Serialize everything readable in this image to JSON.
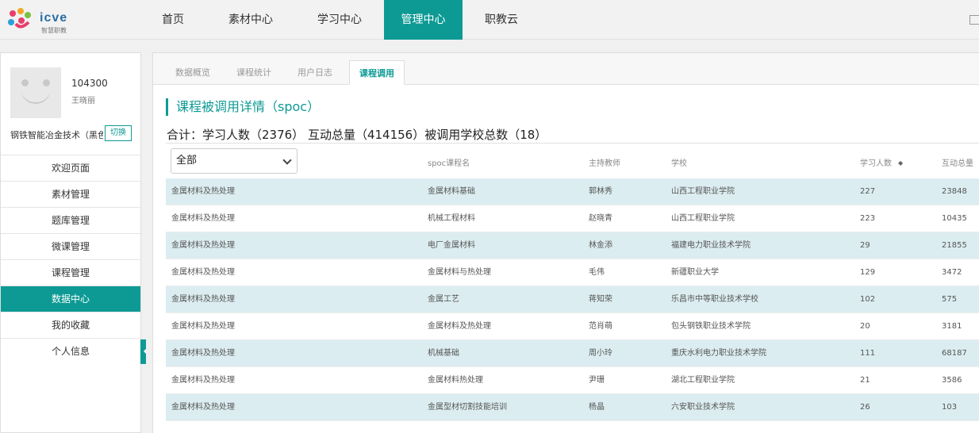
{
  "logo": {
    "text": "icve",
    "subtitle": "智慧职教"
  },
  "nav": [
    {
      "label": "首页"
    },
    {
      "label": "素材中心"
    },
    {
      "label": "学习中心"
    },
    {
      "label": "管理中心"
    },
    {
      "label": "职教云"
    }
  ],
  "user": {
    "id": "104300",
    "name": "王晓丽",
    "course": "钢铁智能冶金技术（黑色冶",
    "switch_label": "切换"
  },
  "menu": [
    {
      "label": "欢迎页面"
    },
    {
      "label": "素材管理"
    },
    {
      "label": "题库管理"
    },
    {
      "label": "微课管理"
    },
    {
      "label": "课程管理"
    },
    {
      "label": "数据中心"
    },
    {
      "label": "我的收藏"
    },
    {
      "label": "个人信息"
    }
  ],
  "tabs": [
    {
      "label": "数据概览"
    },
    {
      "label": "课程统计"
    },
    {
      "label": "用户日志"
    },
    {
      "label": "课程调用"
    }
  ],
  "section_title": "课程被调用详情（spoc）",
  "summary": "合计：学习人数（2376） 互动总量（414156）被调用学校总数（18）",
  "filter": {
    "value": "全部"
  },
  "columns": {
    "spoc": "spoc课程名",
    "teacher": "主持教师",
    "school": "学校",
    "learners": "学习人数",
    "interactions": "互动总量"
  },
  "rows": [
    {
      "course": "金属材料及热处理",
      "spoc": "金属材料基础",
      "teacher": "郭林秀",
      "school": "山西工程职业学院",
      "learners": "227",
      "interactions": "23848"
    },
    {
      "course": "金属材料及热处理",
      "spoc": "机械工程材料",
      "teacher": "赵晓青",
      "school": "山西工程职业学院",
      "learners": "223",
      "interactions": "10435"
    },
    {
      "course": "金属材料及热处理",
      "spoc": "电厂金属材料",
      "teacher": "林金添",
      "school": "福建电力职业技术学院",
      "learners": "29",
      "interactions": "21855"
    },
    {
      "course": "金属材料及热处理",
      "spoc": "金属材料与热处理",
      "teacher": "毛伟",
      "school": "新疆职业大学",
      "learners": "129",
      "interactions": "3472"
    },
    {
      "course": "金属材料及热处理",
      "spoc": "金属工艺",
      "teacher": "蒋知荣",
      "school": "乐昌市中等职业技术学校",
      "learners": "102",
      "interactions": "575"
    },
    {
      "course": "金属材料及热处理",
      "spoc": "金属材料及热处理",
      "teacher": "范肖萌",
      "school": "包头钢铁职业技术学院",
      "learners": "20",
      "interactions": "3181"
    },
    {
      "course": "金属材料及热处理",
      "spoc": "机械基础",
      "teacher": "周小玲",
      "school": "重庆水利电力职业技术学院",
      "learners": "111",
      "interactions": "68187"
    },
    {
      "course": "金属材料及热处理",
      "spoc": "金属材料热处理",
      "teacher": "尹珊",
      "school": "湖北工程职业学院",
      "learners": "21",
      "interactions": "3586"
    },
    {
      "course": "金属材料及热处理",
      "spoc": "金属型材切割技能培训",
      "teacher": "杨晶",
      "school": "六安职业技术学院",
      "learners": "26",
      "interactions": "103"
    }
  ]
}
